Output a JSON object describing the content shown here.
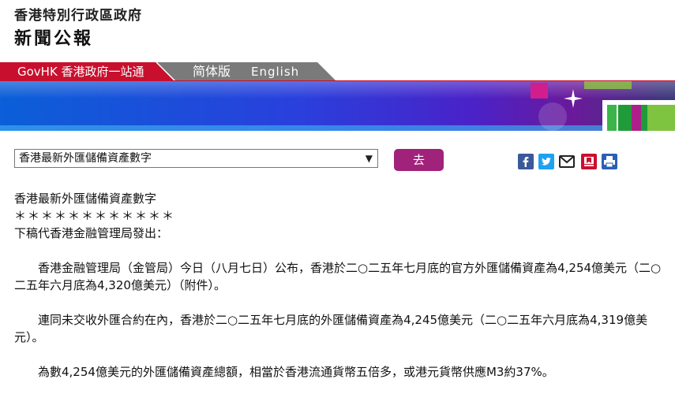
{
  "header": {
    "gov_name": "香港特別行政區政府",
    "bulletin": "新聞公報"
  },
  "nav": {
    "govhk": "GovHK 香港政府一站通",
    "simplified": "简体版",
    "english": "English"
  },
  "controls": {
    "select_value": "香港最新外匯儲備資產數字",
    "go_label": "去"
  },
  "share_icons": [
    "facebook-icon",
    "twitter-icon",
    "email-icon",
    "bookmark-icon",
    "print-icon"
  ],
  "article": {
    "title": "香港最新外匯儲備資產數字",
    "stars": "＊＊＊＊＊＊＊＊＊＊＊＊",
    "issuer": "下稿代香港金融管理局發出：",
    "paragraphs": [
      "香港金融管理局（金管局）今日（八月七日）公布，香港於二○二五年七月底的官方外匯儲備資產為4,254億美元（二○二五年六月底為4,320億美元）（附件）。",
      "連同未交收外匯合約在內，香港於二○二五年七月底的外匯儲備資產為4,245億美元（二○二五年六月底為4,319億美元）。",
      "為數4,254億美元的外匯儲備資產總額，相當於香港流通貨幣五倍多，或港元貨幣供應M3約37%。"
    ]
  },
  "colors": {
    "nav_red": "#c8102e",
    "nav_grey": "#7a7a7a",
    "go_button": "#a0227a",
    "banner_blue": "#1e3ccf"
  }
}
